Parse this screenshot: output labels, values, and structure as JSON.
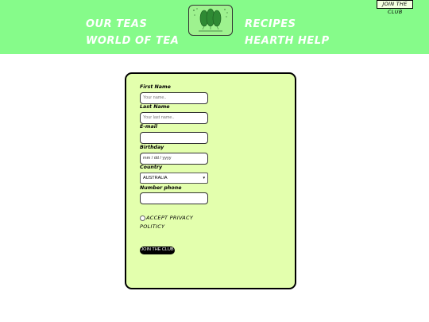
{
  "header": {
    "nav": [
      "OUR TEAS",
      "WORLD OF TEA",
      "RECIPES",
      "HEARTH HELP"
    ],
    "join_line1": "JOIN THE",
    "join_line2": "CLUB",
    "logo_icon": "tea-leaves-icon"
  },
  "form": {
    "first_name_label": "First Name",
    "first_name_placeholder": "Your name..",
    "last_name_label": "Last Name",
    "last_name_placeholder": "Your last name..",
    "email_label": "E-mail",
    "birthday_label": "Birthday",
    "birthday_placeholder": "mm / dd / yyyy",
    "country_label": "Country",
    "country_value": "AUSTRALIA",
    "phone_label": "Number phone",
    "privacy_text": "ACCEPT PRIVACY POLITICY",
    "submit_label": "JOIN THE CLUB"
  },
  "colors": {
    "header": "#86fb8a",
    "card": "#e3ffad",
    "button": "#000000"
  }
}
